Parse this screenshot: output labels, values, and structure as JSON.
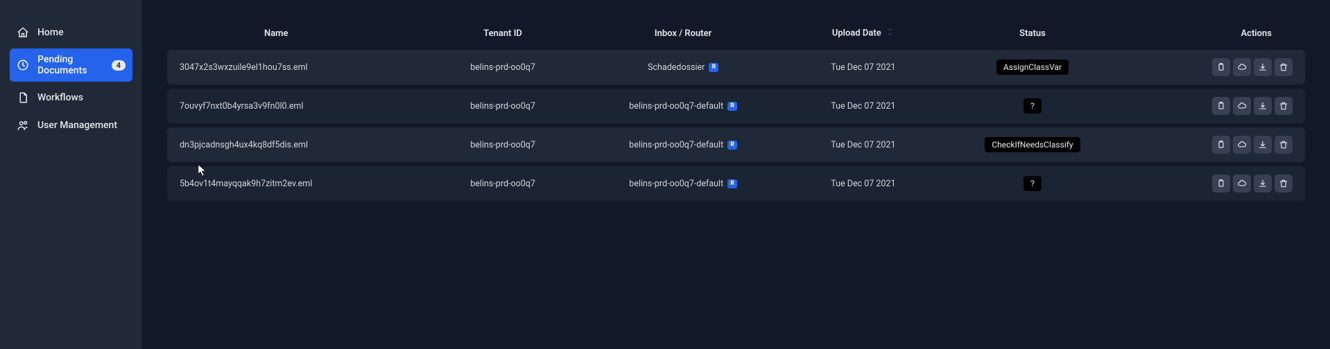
{
  "sidebar": {
    "items": [
      {
        "label": "Home"
      },
      {
        "label": "Pending Documents",
        "badge": "4"
      },
      {
        "label": "Workflows"
      },
      {
        "label": "User Management"
      }
    ]
  },
  "table": {
    "headers": {
      "name": "Name",
      "tenant": "Tenant ID",
      "inbox": "Inbox / Router",
      "upload": "Upload Date",
      "status": "Status",
      "actions": "Actions"
    },
    "r_badge": "R",
    "rows": [
      {
        "name": "3047x2s3wxzuile9el1hou7ss.eml",
        "tenant": "belins-prd-oo0q7",
        "inbox": "Schadedossier",
        "has_r": true,
        "upload": "Tue Dec 07 2021",
        "status": "AssignClassVar"
      },
      {
        "name": "7ouvyf7nxt0b4yrsa3v9fn0l0.eml",
        "tenant": "belins-prd-oo0q7",
        "inbox": "belins-prd-oo0q7-default",
        "has_r": true,
        "upload": "Tue Dec 07 2021",
        "status": "?"
      },
      {
        "name": "dn3pjcadnsgh4ux4kq8df5dis.eml",
        "tenant": "belins-prd-oo0q7",
        "inbox": "belins-prd-oo0q7-default",
        "has_r": true,
        "upload": "Tue Dec 07 2021",
        "status": "CheckIfNeedsClassify"
      },
      {
        "name": "5b4ov1t4mayqqak9h7zitm2ev.eml",
        "tenant": "belins-prd-oo0q7",
        "inbox": "belins-prd-oo0q7-default",
        "has_r": true,
        "upload": "Tue Dec 07 2021",
        "status": "?"
      }
    ]
  }
}
